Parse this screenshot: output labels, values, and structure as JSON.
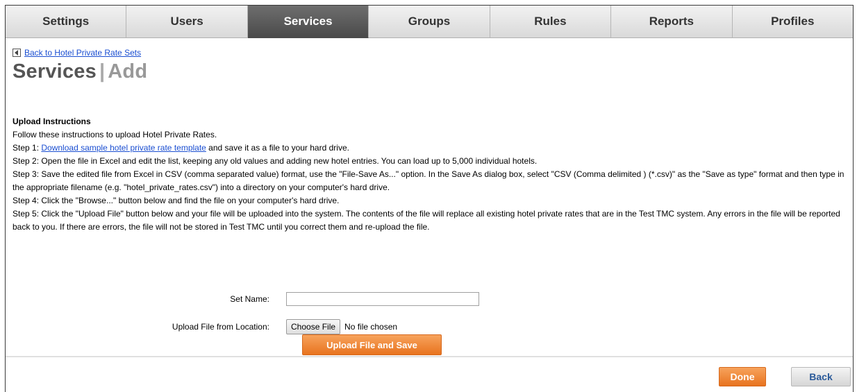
{
  "tabs": [
    {
      "label": "Settings",
      "active": false
    },
    {
      "label": "Users",
      "active": false
    },
    {
      "label": "Services",
      "active": true
    },
    {
      "label": "Groups",
      "active": false
    },
    {
      "label": "Rules",
      "active": false
    },
    {
      "label": "Reports",
      "active": false
    },
    {
      "label": "Profiles",
      "active": false
    }
  ],
  "back_link": {
    "label": "Back to Hotel Private Rate Sets",
    "icon": "triangle-left-icon"
  },
  "title": {
    "main": "Services",
    "separator": "|",
    "sub": "Add"
  },
  "instructions": {
    "heading": "Upload Instructions",
    "intro": "Follow these instructions to upload Hotel Private Rates.",
    "step1_prefix": "Step 1: ",
    "step1_link": "Download sample hotel private rate template",
    "step1_suffix": " and save it as a file to your hard drive.",
    "step2": "Step 2: Open the file in Excel and edit the list, keeping any old values and adding new hotel entries. You can load up to 5,000 individual hotels.",
    "step3": "Step 3: Save the edited file from Excel in CSV (comma separated value) format, use the \"File-Save As...\" option. In the Save As dialog box, select \"CSV (Comma delimited ) (*.csv)\" as the \"Save as type\" format and then type in the appropriate filename (e.g. \"hotel_private_rates.csv\") into a directory on your computer's hard drive.",
    "step4": "Step 4: Click the \"Browse...\" button below and find the file on your computer's hard drive.",
    "step5": "Step 5: Click the \"Upload File\" button below and your file will be uploaded into the system. The contents of the file will replace all existing hotel private rates that are in the Test TMC system. Any errors in the file will be reported back to you. If there are errors, the file will not be stored in Test TMC until you correct them and re-upload the file."
  },
  "form": {
    "set_name_label": "Set Name:",
    "set_name_value": "",
    "upload_label": "Upload File from Location:",
    "choose_file_label": "Choose File",
    "no_file_text": "No file chosen",
    "upload_button": "Upload File and Save"
  },
  "footer": {
    "done_label": "Done",
    "back_label": "Back"
  },
  "colors": {
    "accent_orange": "#e8731f",
    "active_tab": "#4a4a4a",
    "link": "#1a4ed1"
  }
}
